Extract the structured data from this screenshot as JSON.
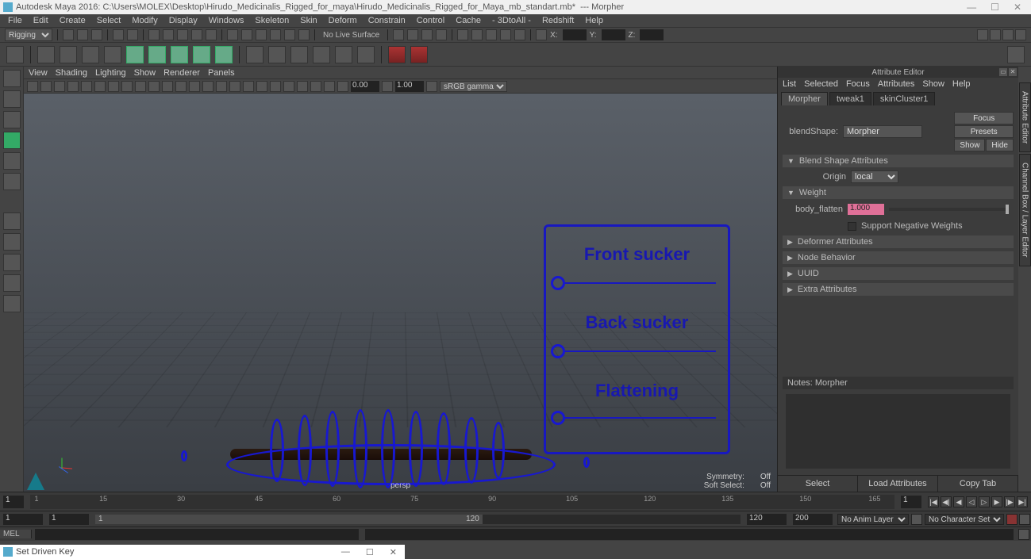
{
  "title": {
    "app": "Autodesk Maya 2016:",
    "path": "C:\\Users\\MOLEX\\Desktop\\Hirudo_Medicinalis_Rigged_for_maya\\Hirudo_Medicinalis_Rigged_for_Maya_mb_standart.mb*",
    "suffix": "---   Morpher"
  },
  "menu": [
    "File",
    "Edit",
    "Create",
    "Select",
    "Modify",
    "Display",
    "Windows",
    "Skeleton",
    "Skin",
    "Deform",
    "Constrain",
    "Control",
    "Cache",
    "- 3DtoAll -",
    "Redshift",
    "Help"
  ],
  "workspace": "Rigging",
  "status": {
    "live": "No Live Surface",
    "xl": "X:",
    "yl": "Y:",
    "zl": "Z:"
  },
  "viewmenu": [
    "View",
    "Shading",
    "Lighting",
    "Show",
    "Renderer",
    "Panels"
  ],
  "viewtoolbar": {
    "near": "0.00",
    "far": "1.00",
    "space": "sRGB gamma"
  },
  "viewport": {
    "camera": "persp",
    "sym_label": "Symmetry:",
    "sym_val": "Off",
    "soft_label": "Soft Select:",
    "soft_val": "Off",
    "hud": {
      "l1": "Front sucker",
      "l2": "Back sucker",
      "l3": "Flattening"
    }
  },
  "attr": {
    "panel_title": "Attribute Editor",
    "menu": [
      "List",
      "Selected",
      "Focus",
      "Attributes",
      "Show",
      "Help"
    ],
    "tabs": [
      "Morpher",
      "tweak1",
      "skinCluster1"
    ],
    "blend_label": "blendShape:",
    "blend_val": "Morpher",
    "btn_focus": "Focus",
    "btn_presets": "Presets",
    "btn_show": "Show",
    "btn_hide": "Hide",
    "sec_bsa": "Blend Shape Attributes",
    "origin_label": "Origin",
    "origin_val": "local",
    "sec_weight": "Weight",
    "w_name": "body_flatten",
    "w_val": "1.000",
    "neg_label": "Support Negative Weights",
    "sec_def": "Deformer Attributes",
    "sec_node": "Node Behavior",
    "sec_uuid": "UUID",
    "sec_extra": "Extra Attributes",
    "notes_label": "Notes: Morpher",
    "foot_select": "Select",
    "foot_load": "Load Attributes",
    "foot_copy": "Copy Tab"
  },
  "side_tabs": [
    "Attribute Editor",
    "Channel Box / Layer Editor"
  ],
  "timeline": {
    "cur": "1",
    "ticks": [
      "1",
      "15",
      "30",
      "45",
      "60",
      "75",
      "90",
      "105",
      "120",
      "135",
      "150",
      "165"
    ],
    "cur_box": "1"
  },
  "range": {
    "start_outer": "1",
    "start_inner": "1",
    "end_inner": "120",
    "end_outer": "120",
    "e1": "120",
    "e2": "200",
    "animlayer": "No Anim Layer",
    "charset": "No Character Set"
  },
  "cmd": {
    "lang": "MEL"
  },
  "subwin": {
    "title": "Set Driven Key"
  }
}
